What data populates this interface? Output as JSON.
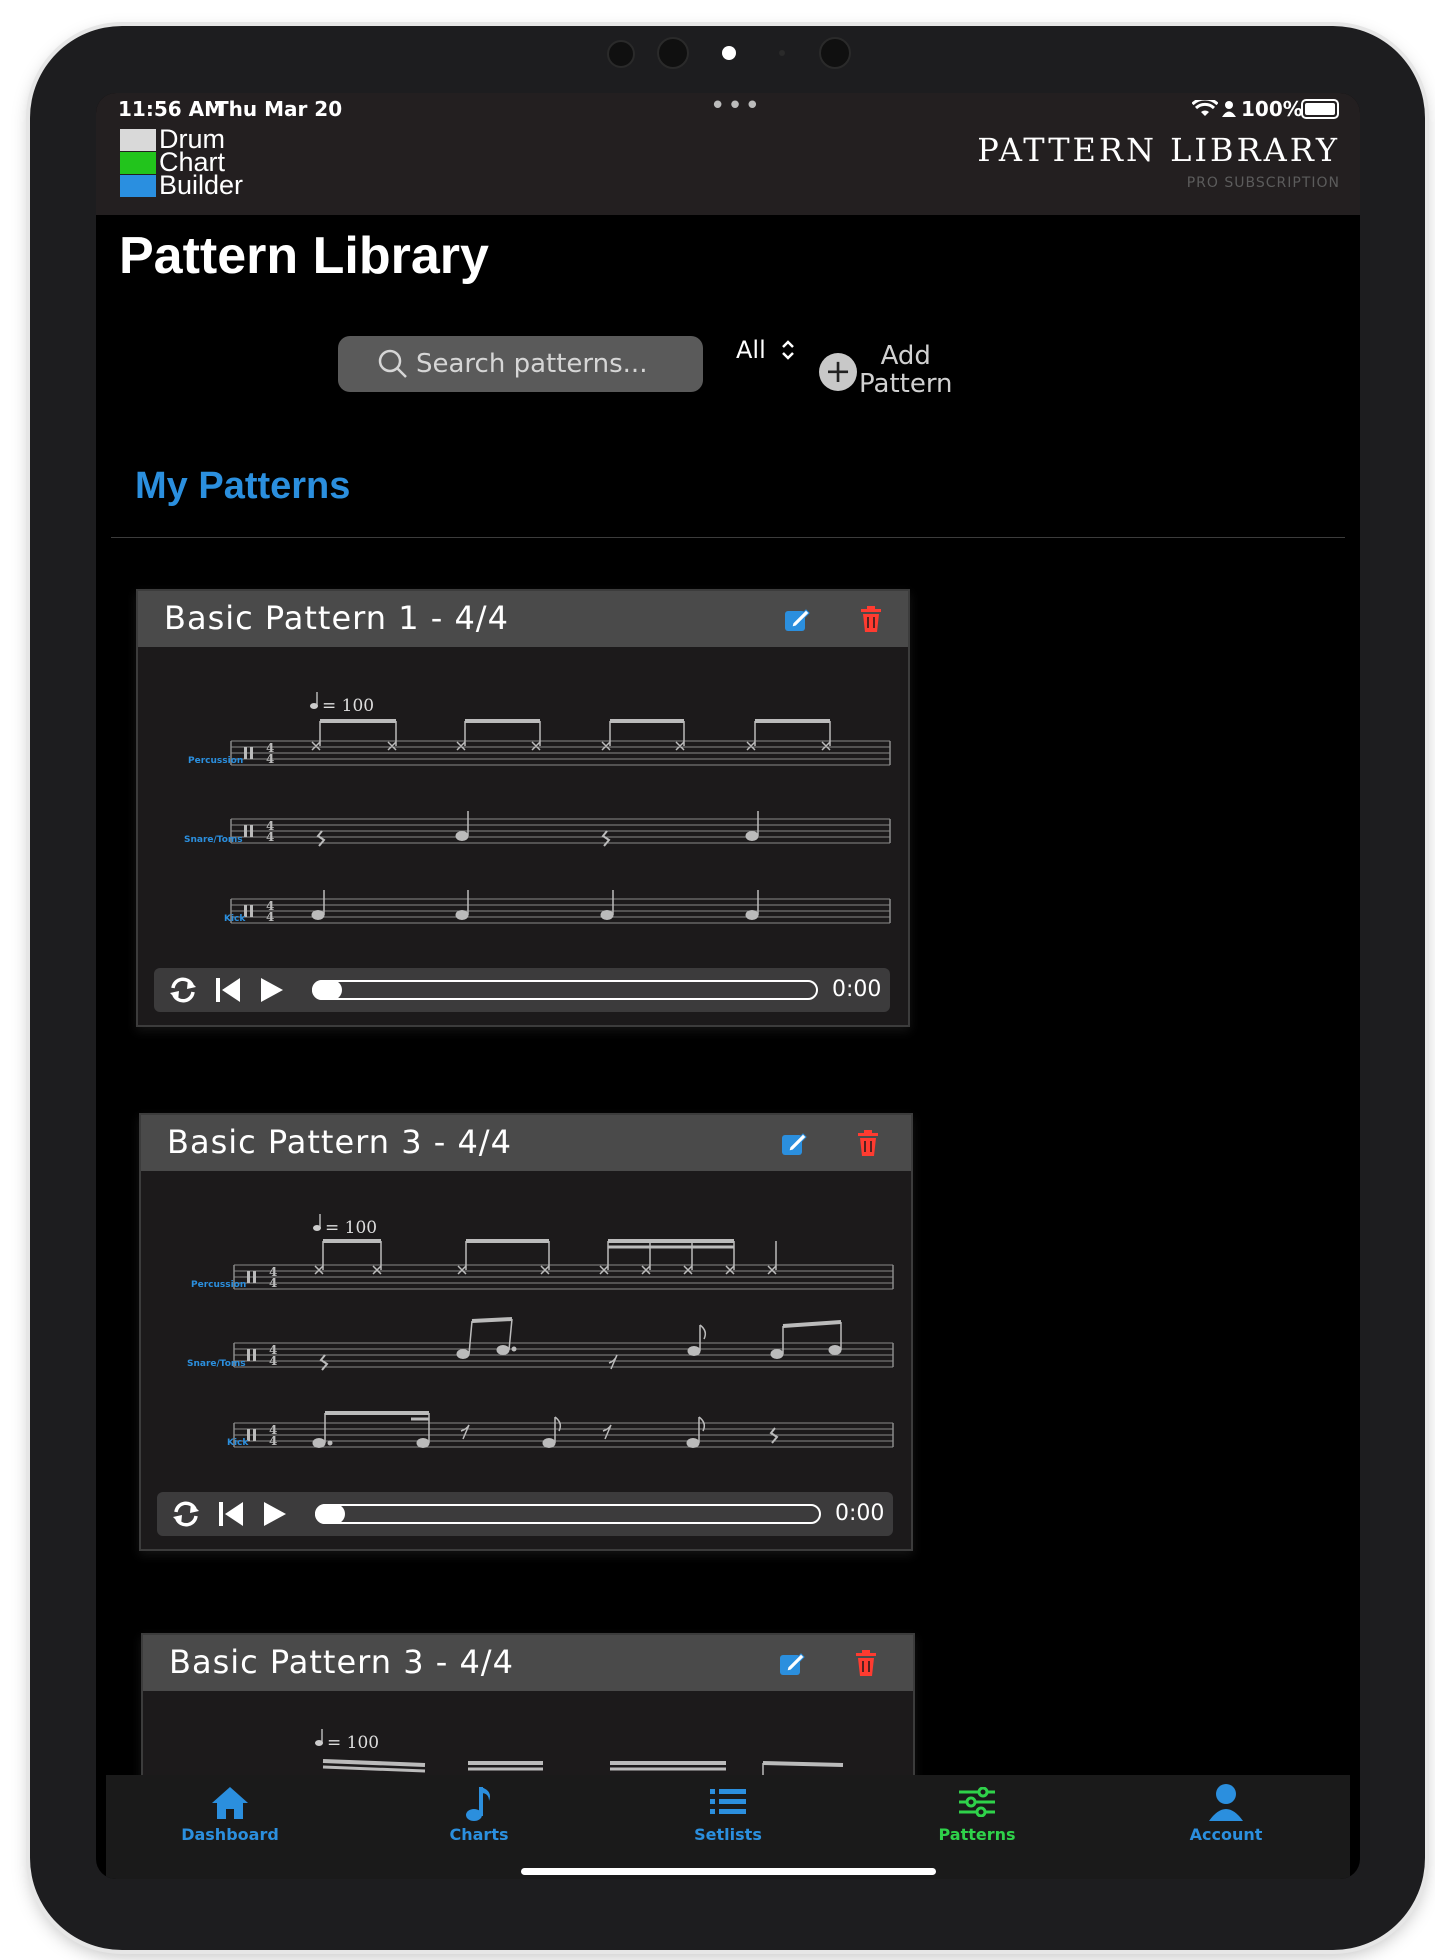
{
  "status_bar": {
    "time": "11:56 AM",
    "date": "Thu Mar 20",
    "battery": "100%",
    "dots": "•••"
  },
  "header": {
    "logo_lines": [
      "Drum",
      "Chart",
      "Builder"
    ],
    "logo_colors": [
      "#d9d9d9",
      "#22c41c",
      "#2a8fe0"
    ],
    "title": "PATTERN LIBRARY",
    "subtitle": "PRO SUBSCRIPTION"
  },
  "page": {
    "title": "Pattern Library",
    "search_placeholder": "Search patterns...",
    "filter_value": "All",
    "add_label_line1": "Add",
    "add_label_line2": "Pattern",
    "section_title": "My Patterns"
  },
  "cards": [
    {
      "title": "Basic Pattern 1 - 4/4",
      "tempo": "= 100",
      "staff_labels": [
        "Percussion",
        "Snare/Toms",
        "Kick"
      ],
      "time": "0:00",
      "playback_progress": 0
    },
    {
      "title": "Basic Pattern 3 - 4/4",
      "tempo": "= 100",
      "staff_labels": [
        "Percussion",
        "Snare/Toms",
        "Kick"
      ],
      "time": "0:00",
      "playback_progress": 0
    },
    {
      "title": "Basic Pattern 3 - 4/4",
      "tempo": "= 100"
    }
  ],
  "tabbar": {
    "tabs": [
      {
        "label": "Dashboard",
        "icon": "house-icon",
        "color": "#2b8fde"
      },
      {
        "label": "Charts",
        "icon": "music-note-icon",
        "color": "#2b8fde"
      },
      {
        "label": "Setlists",
        "icon": "list-icon",
        "color": "#2b8fde"
      },
      {
        "label": "Patterns",
        "icon": "sliders-icon",
        "color": "#2fd24a",
        "active": true
      },
      {
        "label": "Account",
        "icon": "person-icon",
        "color": "#2b8fde"
      }
    ]
  },
  "colors": {
    "accent": "#2b8fde",
    "active_tab": "#2fd24a",
    "delete": "#ff3b30",
    "background": "#000000"
  }
}
